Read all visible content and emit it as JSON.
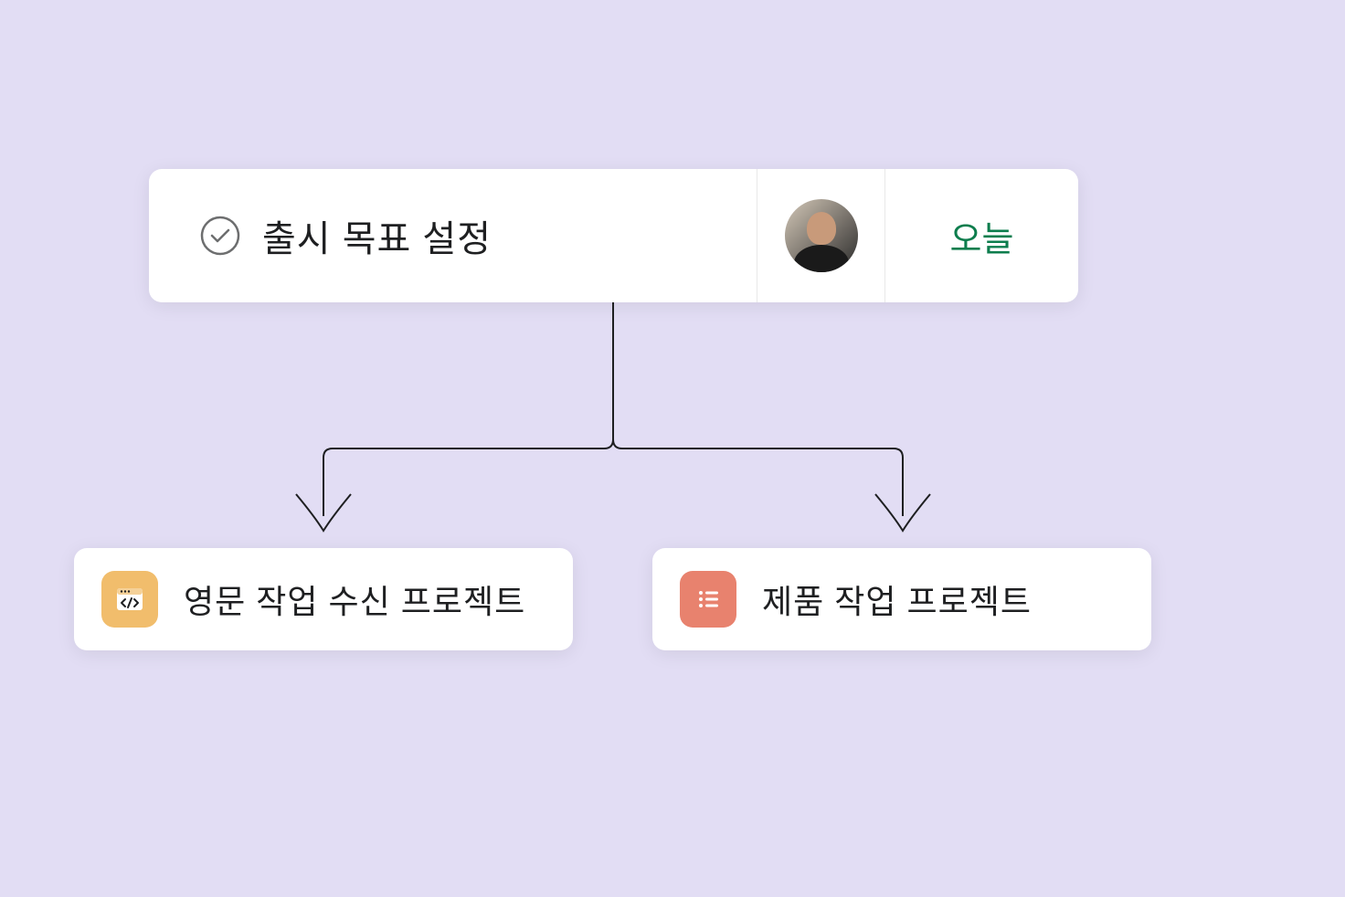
{
  "task": {
    "title": "출시 목표 설정",
    "date_label": "오늘"
  },
  "projects": {
    "left": {
      "title": "영문 작업 수신 프로젝트"
    },
    "right": {
      "title": "제품 작업 프로젝트"
    }
  },
  "colors": {
    "background": "#E2DDF4",
    "accent_green": "#0D7D4D",
    "icon_yellow": "#F1BD6C",
    "icon_coral": "#E8826E"
  }
}
